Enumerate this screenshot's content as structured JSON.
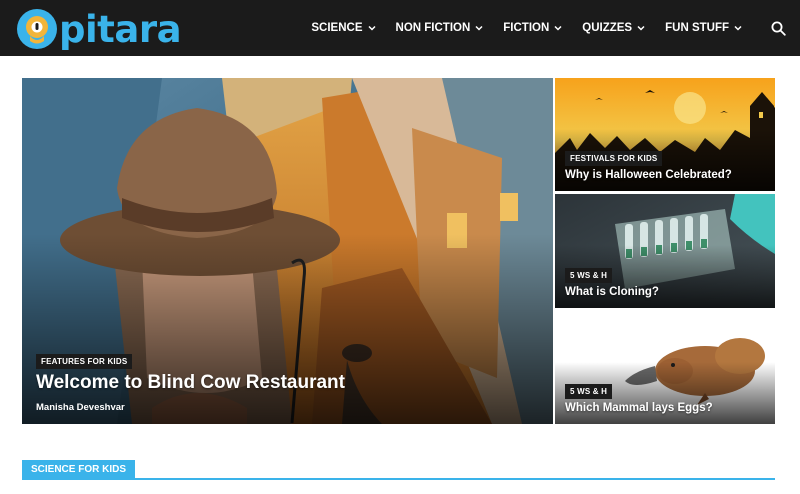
{
  "brand": {
    "name": "pitara",
    "logo_color": "#3ab3ea"
  },
  "nav": {
    "items": [
      {
        "label": "SCIENCE"
      },
      {
        "label": "NON FICTION"
      },
      {
        "label": "FICTION"
      },
      {
        "label": "QUIZZES"
      },
      {
        "label": "FUN STUFF"
      }
    ],
    "search_icon": "search-icon"
  },
  "featured": {
    "category": "FEATURES FOR KIDS",
    "title": "Welcome to Blind Cow Restaurant",
    "author": "Manisha Deveshvar"
  },
  "side_posts": [
    {
      "category": "FESTIVALS FOR KIDS",
      "title": "Why is Halloween Celebrated?"
    },
    {
      "category": "5 WS & H",
      "title": "What is Cloning?"
    },
    {
      "category": "5 WS & H",
      "title": "Which Mammal lays Eggs?"
    }
  ],
  "section": {
    "label": "SCIENCE FOR KIDS",
    "accent": "#3ab3ea"
  }
}
